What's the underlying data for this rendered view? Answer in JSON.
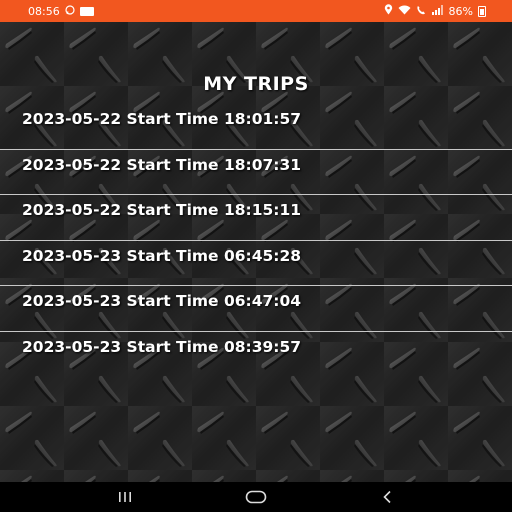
{
  "status_bar": {
    "time": "08:56",
    "battery": "86%",
    "icons": [
      "whatsapp-icon",
      "notification-square-icon",
      "location-icon",
      "wifi-icon",
      "volte-icon",
      "signal-icon",
      "battery-icon"
    ]
  },
  "page": {
    "title": "MY TRIPS"
  },
  "trips": [
    {
      "date": "2023-05-22",
      "label": "Start Time",
      "time": "18:01:57",
      "text": "2023-05-22 Start Time 18:01:57"
    },
    {
      "date": "2023-05-22",
      "label": "Start Time",
      "time": "18:07:31",
      "text": "2023-05-22 Start Time 18:07:31"
    },
    {
      "date": "2023-05-22",
      "label": "Start Time",
      "time": "18:15:11",
      "text": "2023-05-22 Start Time 18:15:11"
    },
    {
      "date": "2023-05-23",
      "label": "Start Time",
      "time": "06:45:28",
      "text": "2023-05-23 Start Time 06:45:28"
    },
    {
      "date": "2023-05-23",
      "label": "Start Time",
      "time": "06:47:04",
      "text": "2023-05-23 Start Time 06:47:04"
    },
    {
      "date": "2023-05-23",
      "label": "Start Time",
      "time": "08:39:57",
      "text": "2023-05-23 Start Time 08:39:57"
    }
  ],
  "nav_bar": {
    "icons": [
      "recent-apps-icon",
      "home-icon",
      "back-icon"
    ]
  },
  "colors": {
    "status_bar": "#f2571f",
    "text": "#ffffff",
    "divider": "#c8c8c8",
    "nav_bar": "#000000"
  }
}
